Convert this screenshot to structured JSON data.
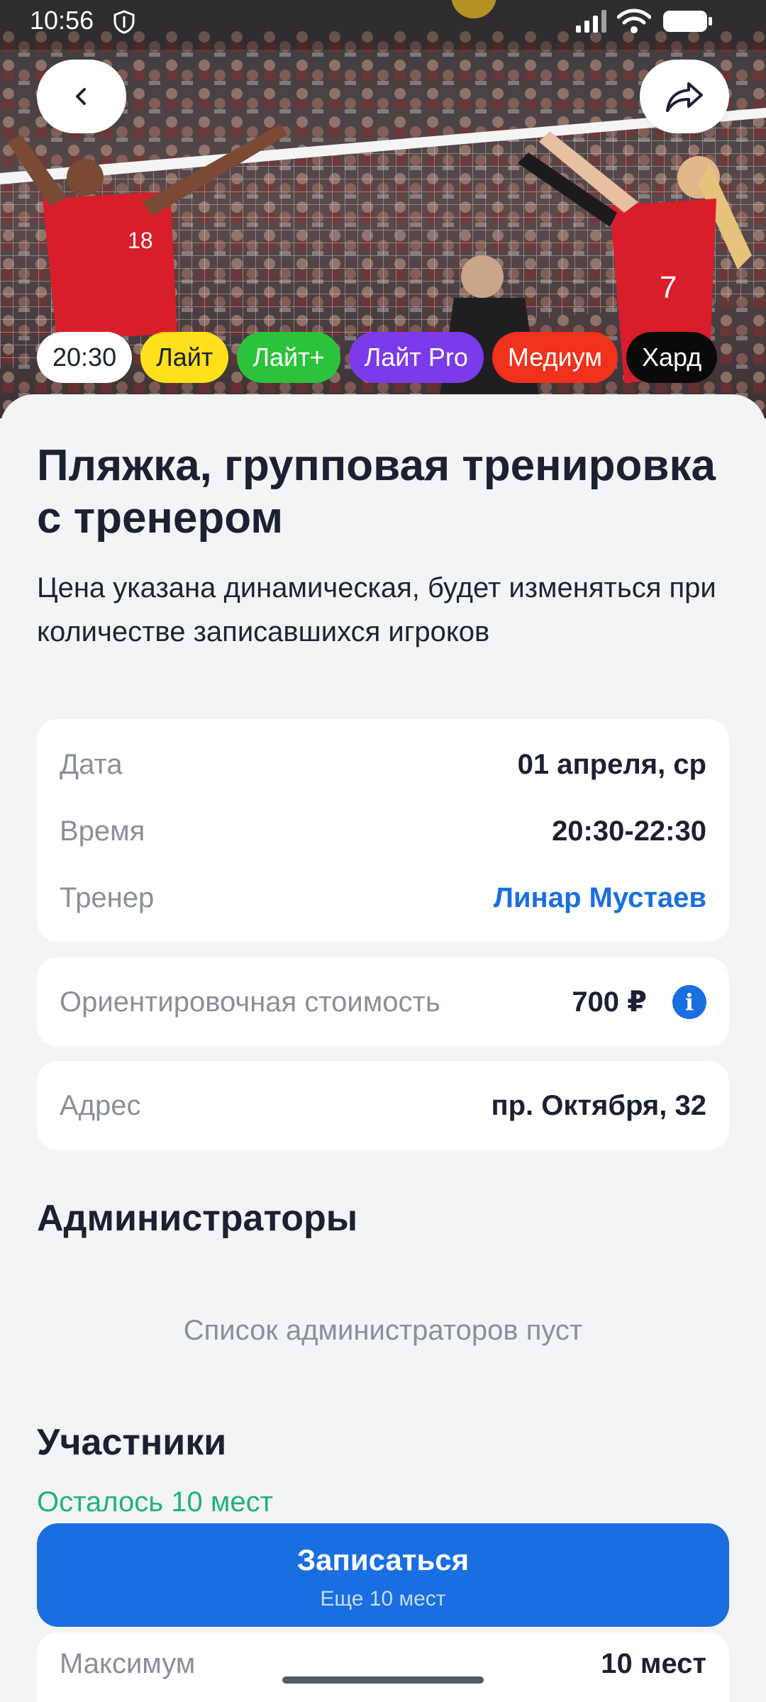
{
  "status_bar": {
    "time": "10:56"
  },
  "hero": {
    "tags": [
      {
        "label": "20:30",
        "bg": "#FFFFFF",
        "fg": "#1B2133"
      },
      {
        "label": "Лайт",
        "bg": "#FFE01A",
        "fg": "#1B2133"
      },
      {
        "label": "Лайт+",
        "bg": "#2BC33B",
        "fg": "#FFFFFF"
      },
      {
        "label": "Лайт Pro",
        "bg": "#7B3BEA",
        "fg": "#FFFFFF"
      },
      {
        "label": "Медиум",
        "bg": "#F0311B",
        "fg": "#FFFFFF"
      },
      {
        "label": "Хард",
        "bg": "#0A0A0A",
        "fg": "#FFFFFF"
      }
    ]
  },
  "event": {
    "title": "Пляжка, групповая тренировка с тренером",
    "subtitle": "Цена указана динамическая, будет изменяться при количестве записавшихся игроков"
  },
  "details": {
    "date_label": "Дата",
    "date_value": "01 апреля, ср",
    "time_label": "Время",
    "time_value": "20:30-22:30",
    "coach_label": "Тренер",
    "coach_value": "Линар Мустаев"
  },
  "price": {
    "label": "Ориентировочная стоимость",
    "value": "700 ₽",
    "info_icon": "i"
  },
  "address": {
    "label": "Адрес",
    "value": "пр. Октября, 32"
  },
  "admins": {
    "title": "Администраторы",
    "empty": "Список администраторов пуст"
  },
  "participants": {
    "title": "Участники",
    "seats_left": "Осталось 10 мест",
    "max_label": "Максимум",
    "max_value": "10 мест"
  },
  "cta": {
    "label": "Записаться",
    "sublabel": "Еще 10 мест"
  },
  "colors": {
    "accent": "#1A6FE0",
    "success": "#22B07D",
    "background": "#F3F4F6"
  }
}
